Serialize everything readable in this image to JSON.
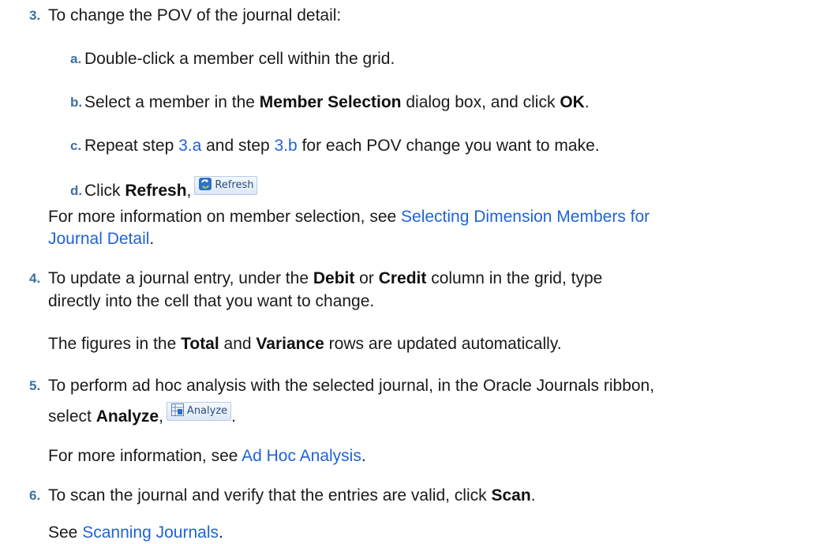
{
  "step3": {
    "num": "3.",
    "text": "To change the POV of the journal detail:",
    "a": {
      "letter": "a.",
      "text": "Double-click a member cell within the grid."
    },
    "b": {
      "letter": "b.",
      "pre": "Select a member in the ",
      "bold1": "Member Selection",
      "mid": " dialog box, and click ",
      "bold2": "OK",
      "post": "."
    },
    "c": {
      "letter": "c.",
      "pre": "Repeat step ",
      "link1": "3.a",
      "mid": " and step ",
      "link2": "3.b",
      "post": " for each POV change you want to make."
    },
    "d": {
      "letter": "d.",
      "pre": "Click ",
      "bold": "Refresh",
      "comma": ",",
      "button_label": "Refresh",
      "button_icon": "refresh-icon"
    },
    "more": {
      "pre": "For more information on member selection, see ",
      "link_line1": "Selecting Dimension Members for",
      "link_line2": "Journal Detail",
      "post": "."
    }
  },
  "step4": {
    "num": "4.",
    "line1_pre": "To update a journal entry, under the ",
    "bold1": "Debit",
    "or": " or ",
    "bold2": "Credit",
    "line1_post": " column in the grid, type",
    "line2": "directly into the cell that you want to change.",
    "note_pre": "The figures in the ",
    "note_bold1": "Total",
    "note_and": " and ",
    "note_bold2": "Variance",
    "note_post": " rows are updated automatically."
  },
  "step5": {
    "num": "5.",
    "line1": "To perform ad hoc analysis with the selected journal, in the Oracle Journals ribbon,",
    "line2_pre": "select ",
    "bold": "Analyze",
    "comma": ",",
    "button_label": "Analyze",
    "button_icon": "analyze-icon",
    "period": ".",
    "more_pre": "For more information, see ",
    "more_link": "Ad Hoc Analysis",
    "more_post": "."
  },
  "step6": {
    "num": "6.",
    "pre": "To scan the journal and verify that the entries are valid, click ",
    "bold": "Scan",
    "post": ".",
    "see_pre": "See ",
    "see_link": "Scanning Journals",
    "see_post": "."
  }
}
